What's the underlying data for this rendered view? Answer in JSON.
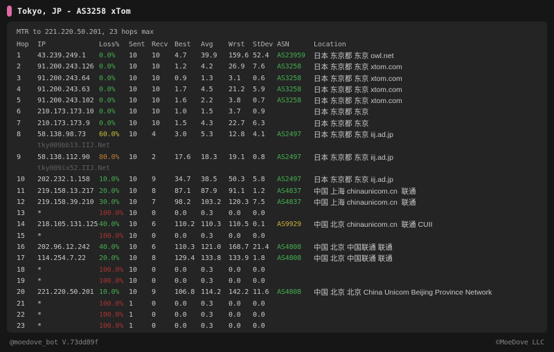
{
  "header": {
    "title": "Tokyo, JP - AS3258 xTom"
  },
  "panel": {
    "subtitle": "MTR to 221.220.50.201, 23 hops max",
    "columns": [
      "Hop",
      "IP",
      "Loss%",
      "Sent",
      "Recv",
      "Best",
      "Avg",
      "Wrst",
      "StDev",
      "ASN",
      "Location"
    ],
    "rows": [
      {
        "hop": "1",
        "ip": "43.239.249.1",
        "host": "",
        "loss": "0.0%",
        "loss_c": "green",
        "sent": "10",
        "recv": "10",
        "best": "4.7",
        "avg": "39.9",
        "wrst": "159.6",
        "stdev": "52.4",
        "asn": "AS23959",
        "asn_c": "green",
        "loc": "日本 东京都 东京 owl.net"
      },
      {
        "hop": "2",
        "ip": "91.200.243.126",
        "host": "",
        "loss": "0.0%",
        "loss_c": "green",
        "sent": "10",
        "recv": "10",
        "best": "1.2",
        "avg": "4.2",
        "wrst": "26.9",
        "stdev": "7.6",
        "asn": "AS3258",
        "asn_c": "green",
        "loc": "日本 东京都 东京 xtom.com"
      },
      {
        "hop": "3",
        "ip": "91.200.243.64",
        "host": "",
        "loss": "0.0%",
        "loss_c": "green",
        "sent": "10",
        "recv": "10",
        "best": "0.9",
        "avg": "1.3",
        "wrst": "3.1",
        "stdev": "0.6",
        "asn": "AS3258",
        "asn_c": "green",
        "loc": "日本 东京都 东京 xtom.com"
      },
      {
        "hop": "4",
        "ip": "91.200.243.63",
        "host": "",
        "loss": "0.0%",
        "loss_c": "green",
        "sent": "10",
        "recv": "10",
        "best": "1.7",
        "avg": "4.5",
        "wrst": "21.2",
        "stdev": "5.9",
        "asn": "AS3258",
        "asn_c": "green",
        "loc": "日本 东京都 东京 xtom.com"
      },
      {
        "hop": "5",
        "ip": "91.200.243.102",
        "host": "",
        "loss": "0.0%",
        "loss_c": "green",
        "sent": "10",
        "recv": "10",
        "best": "1.6",
        "avg": "2.2",
        "wrst": "3.8",
        "stdev": "0.7",
        "asn": "AS3258",
        "asn_c": "green",
        "loc": "日本 东京都 东京 xtom.com"
      },
      {
        "hop": "6",
        "ip": "210.173.173.10",
        "host": "",
        "loss": "0.0%",
        "loss_c": "green",
        "sent": "10",
        "recv": "10",
        "best": "1.0",
        "avg": "1.5",
        "wrst": "3.7",
        "stdev": "0.9",
        "asn": "",
        "asn_c": "",
        "loc": "日本 东京都 东京"
      },
      {
        "hop": "7",
        "ip": "210.173.173.9",
        "host": "",
        "loss": "0.0%",
        "loss_c": "green",
        "sent": "10",
        "recv": "10",
        "best": "1.5",
        "avg": "4.3",
        "wrst": "22.7",
        "stdev": "6.3",
        "asn": "",
        "asn_c": "",
        "loc": "日本 东京都 东京"
      },
      {
        "hop": "8",
        "ip": "58.138.98.73",
        "host": "tky009bb13.IIJ.Net",
        "loss": "60.0%",
        "loss_c": "yellow",
        "sent": "10",
        "recv": "4",
        "best": "3.0",
        "avg": "5.3",
        "wrst": "12.8",
        "stdev": "4.1",
        "asn": "AS2497",
        "asn_c": "green",
        "loc": "日本 东京都 东京 iij.ad.jp"
      },
      {
        "hop": "9",
        "ip": "58.138.112.90",
        "host": "tky009ix52.IIJ.Net",
        "loss": "80.0%",
        "loss_c": "orange",
        "sent": "10",
        "recv": "2",
        "best": "17.6",
        "avg": "18.3",
        "wrst": "19.1",
        "stdev": "0.8",
        "asn": "AS2497",
        "asn_c": "green",
        "loc": "日本 东京都 东京 iij.ad.jp"
      },
      {
        "hop": "10",
        "ip": "202.232.1.158",
        "host": "",
        "loss": "10.0%",
        "loss_c": "green",
        "sent": "10",
        "recv": "9",
        "best": "34.7",
        "avg": "38.5",
        "wrst": "50.3",
        "stdev": "5.8",
        "asn": "AS2497",
        "asn_c": "green",
        "loc": "日本 东京都 东京 iij.ad.jp"
      },
      {
        "hop": "11",
        "ip": "219.158.13.217",
        "host": "",
        "loss": "20.0%",
        "loss_c": "green",
        "sent": "10",
        "recv": "8",
        "best": "87.1",
        "avg": "87.9",
        "wrst": "91.1",
        "stdev": "1.2",
        "asn": "AS4837",
        "asn_c": "green",
        "loc": "中国 上海 chinaunicom.cn  联通"
      },
      {
        "hop": "12",
        "ip": "219.158.39.210",
        "host": "",
        "loss": "30.0%",
        "loss_c": "green",
        "sent": "10",
        "recv": "7",
        "best": "98.2",
        "avg": "103.2",
        "wrst": "120.3",
        "stdev": "7.5",
        "asn": "AS4837",
        "asn_c": "green",
        "loc": "中国 上海 chinaunicom.cn  联通"
      },
      {
        "hop": "13",
        "ip": "*",
        "host": "",
        "loss": "100.0%",
        "loss_c": "red",
        "sent": "10",
        "recv": "0",
        "best": "0.0",
        "avg": "0.3",
        "wrst": "0.0",
        "stdev": "0.0",
        "asn": "",
        "asn_c": "",
        "loc": ""
      },
      {
        "hop": "14",
        "ip": "218.105.131.125",
        "host": "",
        "loss": "40.0%",
        "loss_c": "green",
        "sent": "10",
        "recv": "6",
        "best": "110.2",
        "avg": "110.3",
        "wrst": "110.5",
        "stdev": "0.1",
        "asn": "AS9929",
        "asn_c": "asn_yellow",
        "loc": "中国 北京 chinaunicom.cn  联通 CUII"
      },
      {
        "hop": "15",
        "ip": "*",
        "host": "",
        "loss": "100.0%",
        "loss_c": "red",
        "sent": "10",
        "recv": "0",
        "best": "0.0",
        "avg": "0.3",
        "wrst": "0.0",
        "stdev": "0.0",
        "asn": "",
        "asn_c": "",
        "loc": ""
      },
      {
        "hop": "16",
        "ip": "202.96.12.242",
        "host": "",
        "loss": "40.0%",
        "loss_c": "green",
        "sent": "10",
        "recv": "6",
        "best": "110.3",
        "avg": "121.0",
        "wrst": "168.7",
        "stdev": "21.4",
        "asn": "AS4808",
        "asn_c": "green",
        "loc": "中国 北京 中国联通 联通"
      },
      {
        "hop": "17",
        "ip": "114.254.7.22",
        "host": "",
        "loss": "20.0%",
        "loss_c": "green",
        "sent": "10",
        "recv": "8",
        "best": "129.4",
        "avg": "133.8",
        "wrst": "133.9",
        "stdev": "1.8",
        "asn": "AS4808",
        "asn_c": "green",
        "loc": "中国 北京 中国联通 联通"
      },
      {
        "hop": "18",
        "ip": "*",
        "host": "",
        "loss": "100.0%",
        "loss_c": "red",
        "sent": "10",
        "recv": "0",
        "best": "0.0",
        "avg": "0.3",
        "wrst": "0.0",
        "stdev": "0.0",
        "asn": "",
        "asn_c": "",
        "loc": ""
      },
      {
        "hop": "19",
        "ip": "*",
        "host": "",
        "loss": "100.0%",
        "loss_c": "red",
        "sent": "10",
        "recv": "0",
        "best": "0.0",
        "avg": "0.3",
        "wrst": "0.0",
        "stdev": "0.0",
        "asn": "",
        "asn_c": "",
        "loc": ""
      },
      {
        "hop": "20",
        "ip": "221.220.50.201",
        "host": "",
        "loss": "10.0%",
        "loss_c": "green",
        "sent": "10",
        "recv": "9",
        "best": "106.8",
        "avg": "114.2",
        "wrst": "142.2",
        "stdev": "11.6",
        "asn": "AS4808",
        "asn_c": "green",
        "loc": "中国 北京 北京 China Unicom Beijing Province Network"
      },
      {
        "hop": "21",
        "ip": "*",
        "host": "",
        "loss": "100.0%",
        "loss_c": "red",
        "sent": "1",
        "recv": "0",
        "best": "0.0",
        "avg": "0.3",
        "wrst": "0.0",
        "stdev": "0.0",
        "asn": "",
        "asn_c": "",
        "loc": ""
      },
      {
        "hop": "22",
        "ip": "*",
        "host": "",
        "loss": "100.0%",
        "loss_c": "red",
        "sent": "1",
        "recv": "0",
        "best": "0.0",
        "avg": "0.3",
        "wrst": "0.0",
        "stdev": "0.0",
        "asn": "",
        "asn_c": "",
        "loc": ""
      },
      {
        "hop": "23",
        "ip": "*",
        "host": "",
        "loss": "100.0%",
        "loss_c": "red",
        "sent": "1",
        "recv": "0",
        "best": "0.0",
        "avg": "0.3",
        "wrst": "0.0",
        "stdev": "0.0",
        "asn": "",
        "asn_c": "",
        "loc": ""
      }
    ]
  },
  "footer": {
    "left": "@moedove_bot V.73dd89f",
    "right": "©MoeDove LLC"
  },
  "colors": {
    "bg": "#161616",
    "panel_bg": "#242424",
    "accent": "#e06aa3",
    "title_text": "#ededed",
    "text": "#c9c9c9",
    "muted": "#b3b3b3",
    "host": "#5e5e5e",
    "footer_text": "#858585",
    "green": "#44ad4f",
    "yellow": "#c3bd3a",
    "orange": "#c07f35",
    "red": "#aa3232",
    "asn_yellow": "#c8ae3a"
  }
}
